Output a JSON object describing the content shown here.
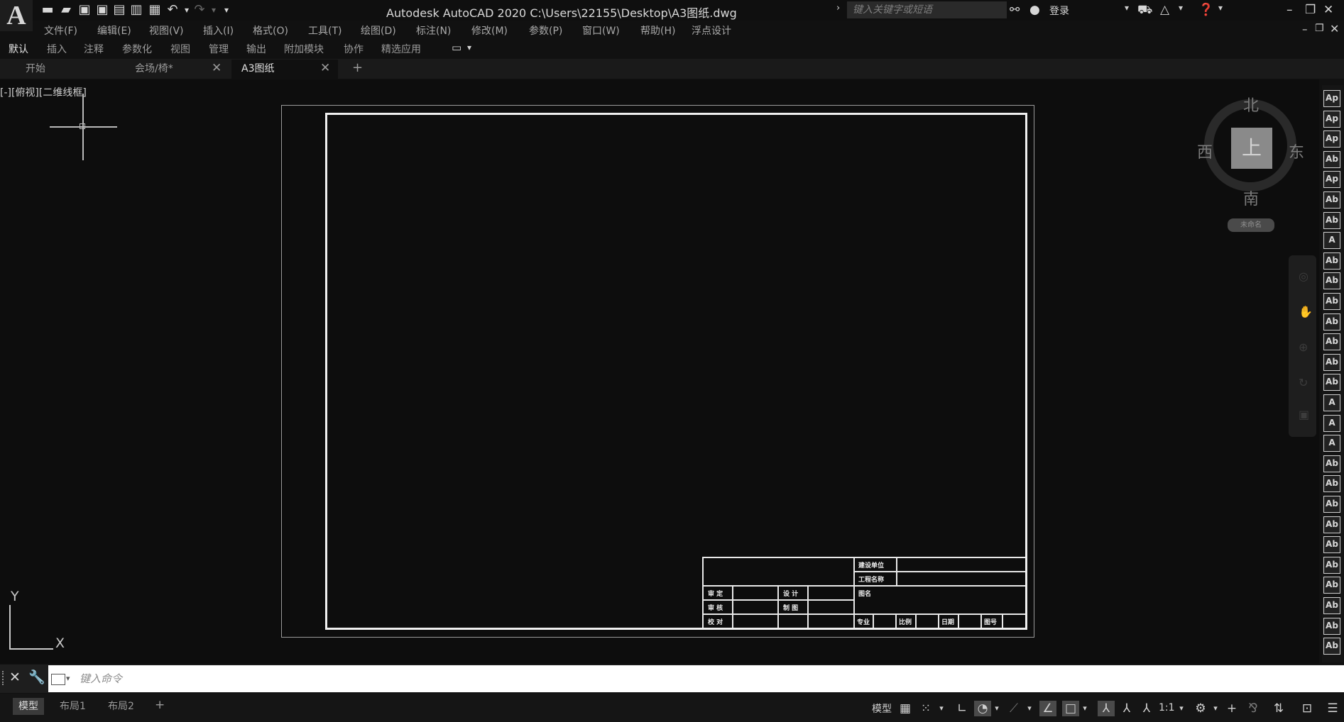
{
  "window": {
    "logo": "A",
    "title": "Autodesk AutoCAD 2020    C:\\Users\\22155\\Desktop\\A3图纸.dwg",
    "search_placeholder": "键入关键字或短语",
    "signin_label": "登录"
  },
  "menubar": {
    "items": [
      "文件(F)",
      "编辑(E)",
      "视图(V)",
      "插入(I)",
      "格式(O)",
      "工具(T)",
      "绘图(D)",
      "标注(N)",
      "修改(M)",
      "参数(P)",
      "窗口(W)",
      "帮助(H)",
      "浮点设计"
    ]
  },
  "ribbon_tabs": [
    "默认",
    "插入",
    "注释",
    "参数化",
    "视图",
    "管理",
    "输出",
    "附加模块",
    "协作",
    "精选应用"
  ],
  "file_tabs": [
    {
      "label": "开始"
    },
    {
      "label": "会场/椅*"
    },
    {
      "label": "A3图纸"
    }
  ],
  "viewport": {
    "label": "[-][俯视][二维线框]"
  },
  "viewcube": {
    "north": "北",
    "south": "南",
    "east": "东",
    "west": "西",
    "top": "上",
    "wcs": "未命名"
  },
  "ucs": {
    "x": "X",
    "y": "Y"
  },
  "title_block": {
    "construction_unit": "建设单位",
    "project_name": "工程名称",
    "drawing_name": "图名",
    "approve": "审  定",
    "review": "审  核",
    "check": "校  对",
    "design": "设  计",
    "draft": "制  图",
    "specialty": "专业",
    "scale": "比例",
    "date": "日期",
    "sheet_no": "图号"
  },
  "right_toolbar_icons": [
    "Ap",
    "Ap",
    "Ap",
    "Ab",
    "Ap",
    "Ab",
    "Ab",
    "A",
    "Ab",
    "Ab",
    "Ab",
    "Ab",
    "Ab",
    "Ab",
    "Ab",
    "A",
    "A",
    "A",
    "Ab",
    "Ab",
    "Ab",
    "Ab",
    "Ab",
    "Ab",
    "Ab",
    "Ab",
    "Ab",
    "Ab"
  ],
  "command": {
    "placeholder": "键入命令"
  },
  "layout_tabs": [
    "模型",
    "布局1",
    "布局2"
  ],
  "status": {
    "model_label": "模型",
    "scale": "1:1"
  }
}
